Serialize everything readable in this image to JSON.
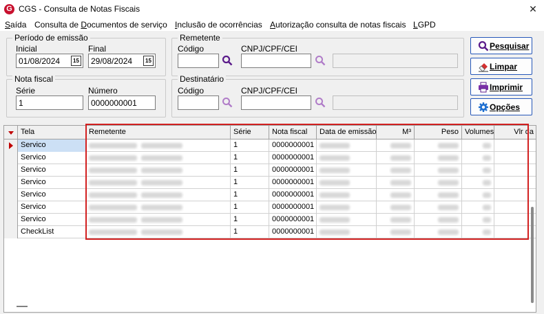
{
  "window": {
    "title": "CGS - Consulta de Notas Fiscais",
    "logo_letter": "G",
    "close_glyph": "✕"
  },
  "menu": [
    {
      "label": "Saída",
      "accel": "S",
      "rest": "aída"
    },
    {
      "label": "Consulta de Documentos de serviço",
      "pre": "Consulta de ",
      "accel": "D",
      "rest": "ocumentos de serviço"
    },
    {
      "label": "Inclusão de ocorrências",
      "accel": "I",
      "rest": "nclusão de ocorrências"
    },
    {
      "label": "Autorização consulta de notas fiscais",
      "accel": "A",
      "rest": "utorização consulta de notas fiscais"
    },
    {
      "label": "LGPD",
      "accel": "L",
      "rest": "GPD"
    }
  ],
  "periodo": {
    "group_label": "Período de emissão",
    "inicial_label": "Inicial",
    "inicial_value": "01/08/2024",
    "final_label": "Final",
    "final_value": "29/08/2024",
    "cal_glyph": "15"
  },
  "remetente": {
    "group_label": "Remetente",
    "codigo_label": "Código",
    "codigo_value": "",
    "cnpj_label": "CNPJ/CPF/CEI",
    "cnpj_value": "",
    "nome_value": ""
  },
  "nota_fiscal": {
    "group_label": "Nota fiscal",
    "serie_label": "Série",
    "serie_value": "1",
    "numero_label": "Número",
    "numero_value": "0000000001"
  },
  "destinatario": {
    "group_label": "Destinatário",
    "codigo_label": "Código",
    "codigo_value": "",
    "cnpj_label": "CNPJ/CPF/CEI",
    "cnpj_value": "",
    "nome_value": ""
  },
  "buttons": {
    "pesquisar": "Pesquisar",
    "limpar": "Limpar",
    "imprimir": "Imprimir",
    "opcoes": "Opções"
  },
  "grid": {
    "columns": [
      "Tela",
      "Remetente",
      "Série",
      "Nota fiscal",
      "Data de emissão",
      "M³",
      "Peso",
      "Volumes",
      "Vlr da"
    ],
    "rows": [
      {
        "tela": "Servico",
        "serie": "1",
        "nota": "0000000001"
      },
      {
        "tela": "Servico",
        "serie": "1",
        "nota": "0000000001"
      },
      {
        "tela": "Servico",
        "serie": "1",
        "nota": "0000000001"
      },
      {
        "tela": "Servico",
        "serie": "1",
        "nota": "0000000001"
      },
      {
        "tela": "Servico",
        "serie": "1",
        "nota": "0000000001"
      },
      {
        "tela": "Servico",
        "serie": "1",
        "nota": "0000000001"
      },
      {
        "tela": "Servico",
        "serie": "1",
        "nota": "0000000001"
      },
      {
        "tela": "CheckList",
        "serie": "1",
        "nota": "0000000001"
      }
    ],
    "selected_row": 0
  },
  "colors": {
    "highlight_border": "#d21f1f",
    "button_border": "#2456b8",
    "selected_row": "#cce0f5",
    "magnifier": "#6a1b9a"
  }
}
